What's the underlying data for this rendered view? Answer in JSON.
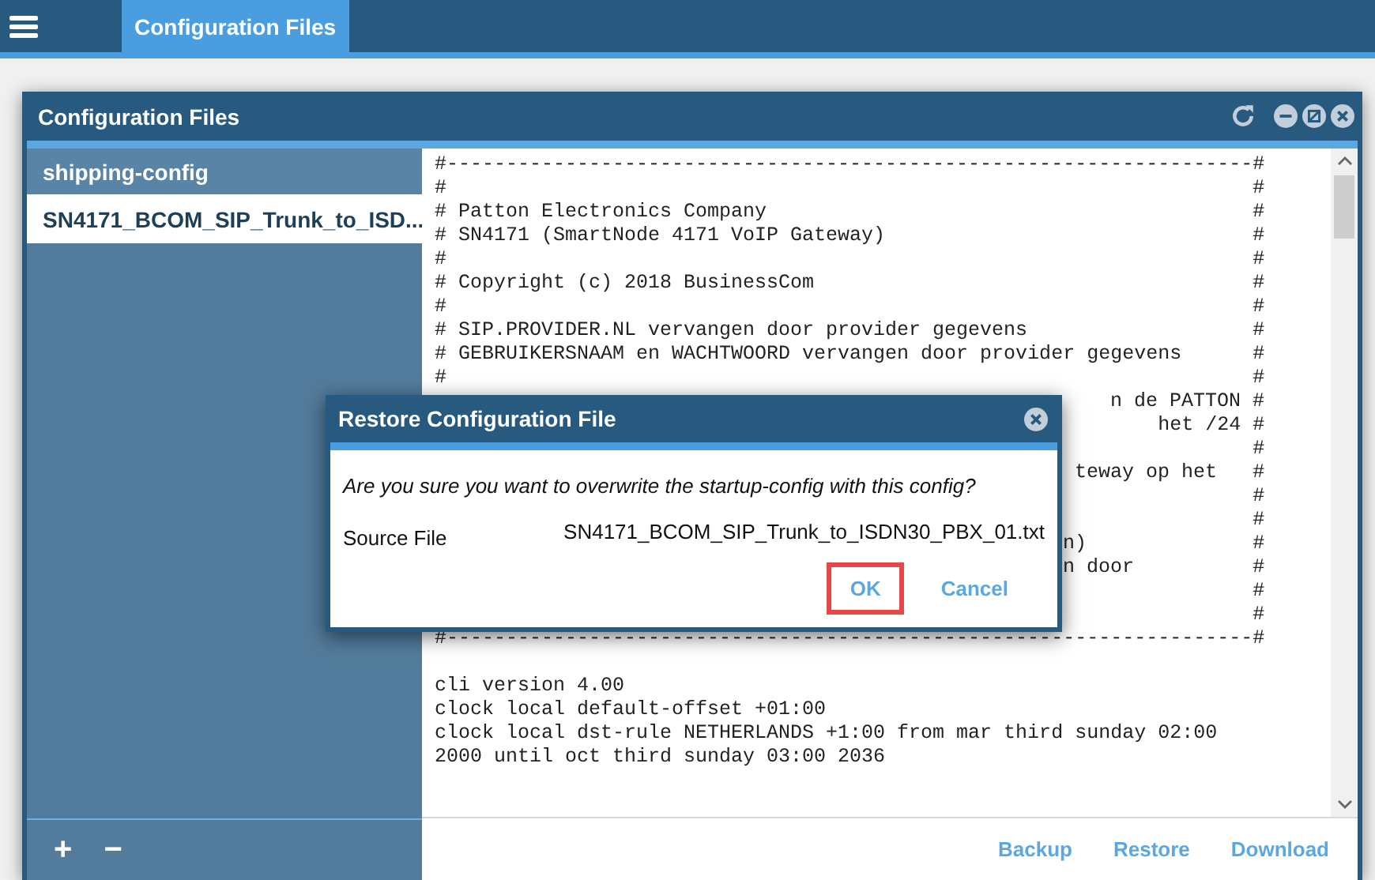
{
  "top_bar": {
    "tabs": [
      {
        "label": "Configuration Files",
        "selected": true
      }
    ]
  },
  "window": {
    "title": "Configuration Files",
    "sidebar": {
      "groups": [
        {
          "label": "shipping-config",
          "items": [
            {
              "label": "SN4171_BCOM_SIP_Trunk_to_ISD...",
              "selected": true
            }
          ]
        }
      ],
      "footer": [
        "+",
        "−"
      ]
    },
    "editor": {
      "lines": [
        {
          "kind": "full",
          "text": "#--------------------------------------------------------------------#"
        },
        {
          "kind": "pair",
          "left": "#",
          "right": "#"
        },
        {
          "kind": "pair",
          "left": "# Patton Electronics Company",
          "right": "#"
        },
        {
          "kind": "pair",
          "left": "# SN4171 (SmartNode 4171 VoIP Gateway)",
          "right": "#"
        },
        {
          "kind": "pair",
          "left": "#",
          "right": "#"
        },
        {
          "kind": "pair",
          "left": "# Copyright (c) 2018 BusinessCom",
          "right": "#"
        },
        {
          "kind": "pair",
          "left": "#",
          "right": "#"
        },
        {
          "kind": "pair",
          "left": "# SIP.PROVIDER.NL vervangen door provider gegevens",
          "right": "#"
        },
        {
          "kind": "pair",
          "left": "# GEBRUIKERSNAAM en WACHTWOORD vervangen door provider gegevens",
          "right": "#"
        },
        {
          "kind": "pair",
          "left": "#",
          "right": "#"
        },
        {
          "kind": "tail",
          "text": "n de PATTON #"
        },
        {
          "kind": "tail",
          "text": "het /24 #"
        },
        {
          "kind": "tail",
          "text": "#"
        },
        {
          "kind": "tail",
          "text": "teway op het   #"
        },
        {
          "kind": "tail",
          "text": "#"
        },
        {
          "kind": "tail",
          "text": "#"
        },
        {
          "kind": "tail",
          "text": "n)              #"
        },
        {
          "kind": "tail",
          "text": "n door          #"
        },
        {
          "kind": "tail",
          "text": "#"
        },
        {
          "kind": "tail",
          "text": "#"
        },
        {
          "kind": "full",
          "text": "#--------------------------------------------------------------------#"
        },
        {
          "kind": "blank"
        },
        {
          "kind": "full",
          "text": "cli version 4.00"
        },
        {
          "kind": "full",
          "text": "clock local default-offset +01:00"
        },
        {
          "kind": "full",
          "text": "clock local dst-rule NETHERLANDS +1:00 from mar third sunday 02:00"
        },
        {
          "kind": "full",
          "text": "2000 until oct third sunday 03:00 2036"
        },
        {
          "kind": "blank"
        }
      ]
    },
    "footer_buttons": [
      "Backup",
      "Restore",
      "Download"
    ]
  },
  "dialog": {
    "title": "Restore Configuration File",
    "message": "Are you sure you want to overwrite the startup-config with this config?",
    "fields": [
      {
        "label": "Source File",
        "value": "SN4171_BCOM_SIP_Trunk_to_ISDN30_PBX_01.txt"
      }
    ],
    "buttons": [
      {
        "label": "OK",
        "selected": true
      },
      {
        "label": "Cancel",
        "selected": false
      }
    ]
  }
}
